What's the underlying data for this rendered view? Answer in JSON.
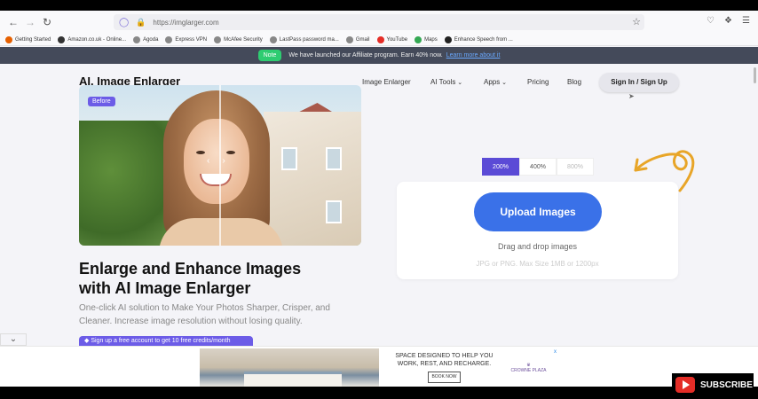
{
  "browser": {
    "url": "https://imglarger.com",
    "bookmarks": [
      {
        "label": "Getting Started",
        "icon": "firefox-icon",
        "color": "#e66000"
      },
      {
        "label": "Amazon.co.uk - Online...",
        "icon": "amazon-icon",
        "color": "#333333"
      },
      {
        "label": "Agoda",
        "icon": "globe-icon",
        "color": "#888888"
      },
      {
        "label": "Express VPN",
        "icon": "globe-icon",
        "color": "#888888"
      },
      {
        "label": "McAfee Security",
        "icon": "globe-icon",
        "color": "#888888"
      },
      {
        "label": "LastPass password ma...",
        "icon": "globe-icon",
        "color": "#888888"
      },
      {
        "label": "Gmail",
        "icon": "globe-icon",
        "color": "#888888"
      },
      {
        "label": "YouTube",
        "icon": "youtube-icon",
        "color": "#e52d27"
      },
      {
        "label": "Maps",
        "icon": "maps-icon",
        "color": "#34a853"
      },
      {
        "label": "Enhance Speech from ...",
        "icon": "adobe-icon",
        "color": "#222222"
      }
    ]
  },
  "banner": {
    "badge": "Note",
    "message": "We have launched our Affiliate program. Earn 40% now.",
    "link": "Learn more about it"
  },
  "header": {
    "logo": "AI. Image Enlarger",
    "nav": [
      "Image Enlarger",
      "AI Tools",
      "Apps",
      "Pricing",
      "Blog"
    ],
    "signin": "Sign In / Sign Up"
  },
  "hero": {
    "before_label": "Before",
    "headline_line1": "Enlarge and Enhance Images",
    "headline_line2": "with AI Image Enlarger",
    "subtext": "One-click AI solution to Make Your Photos Sharper, Crisper, and Cleaner. Increase image resolution without losing quality.",
    "promo": "Sign up a free account to get 10 free credits/month"
  },
  "upload": {
    "scales": [
      "200%",
      "400%",
      "800%"
    ],
    "active_scale": "200%",
    "button": "Upload Images",
    "drag_text": "Drag and drop images",
    "limits": "JPG or PNG. Max Size 1MB or 1200px"
  },
  "ad": {
    "headline": "SPACE DESIGNED TO HELP YOU WORK, REST, AND RECHARGE.",
    "cta": "BOOK NOW",
    "brand": "CROWNE PLAZA",
    "close": "x"
  },
  "overlay": {
    "subscribe": "SUBSCRIBE"
  },
  "colors": {
    "accent": "#5b4bd6",
    "upload_button": "#3a71e8",
    "banner_bg": "#444a5a",
    "note_badge": "#2ecc71"
  }
}
